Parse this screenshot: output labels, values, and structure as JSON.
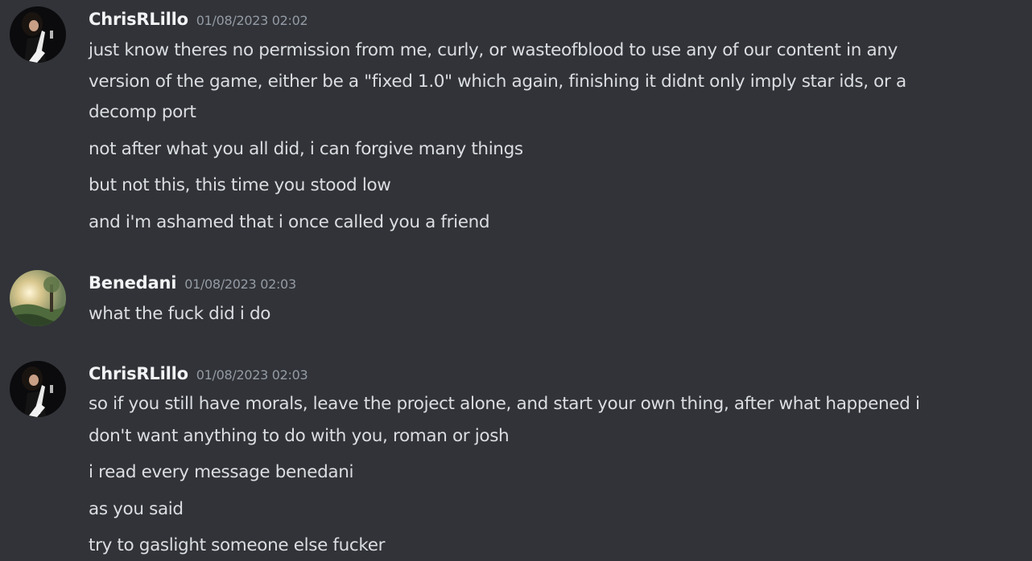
{
  "messages": [
    {
      "author": "ChrisRLillo",
      "timestamp": "01/08/2023 02:02",
      "avatar": "guitarist-avatar",
      "lines": [
        "just know theres no permission from me, curly, or wasteofblood to use any of our content in any",
        "version of the game, either be a \"fixed 1.0\" which again, finishing it didnt only imply star ids, or a",
        "decomp port",
        "not after what you all did, i can forgive many things",
        "but not this, this time you stood low",
        "and i'm ashamed that i once called you a friend"
      ]
    },
    {
      "author": "Benedani",
      "timestamp": "01/08/2023 02:03",
      "avatar": "landscape-avatar",
      "lines": [
        "what the fuck did i do"
      ]
    },
    {
      "author": "ChrisRLillo",
      "timestamp": "01/08/2023 02:03",
      "avatar": "guitarist-avatar",
      "lines": [
        "so if you still have morals, leave the project alone, and start your own thing, after what happened i",
        "don't want anything to do with you, roman or josh",
        "i read every message benedani",
        "as you said",
        "try to gaslight someone else fucker"
      ]
    }
  ],
  "colors": {
    "background": "#313338",
    "username": "#f2f3f5",
    "timestamp": "#949ba4",
    "text": "#dbdee1"
  }
}
